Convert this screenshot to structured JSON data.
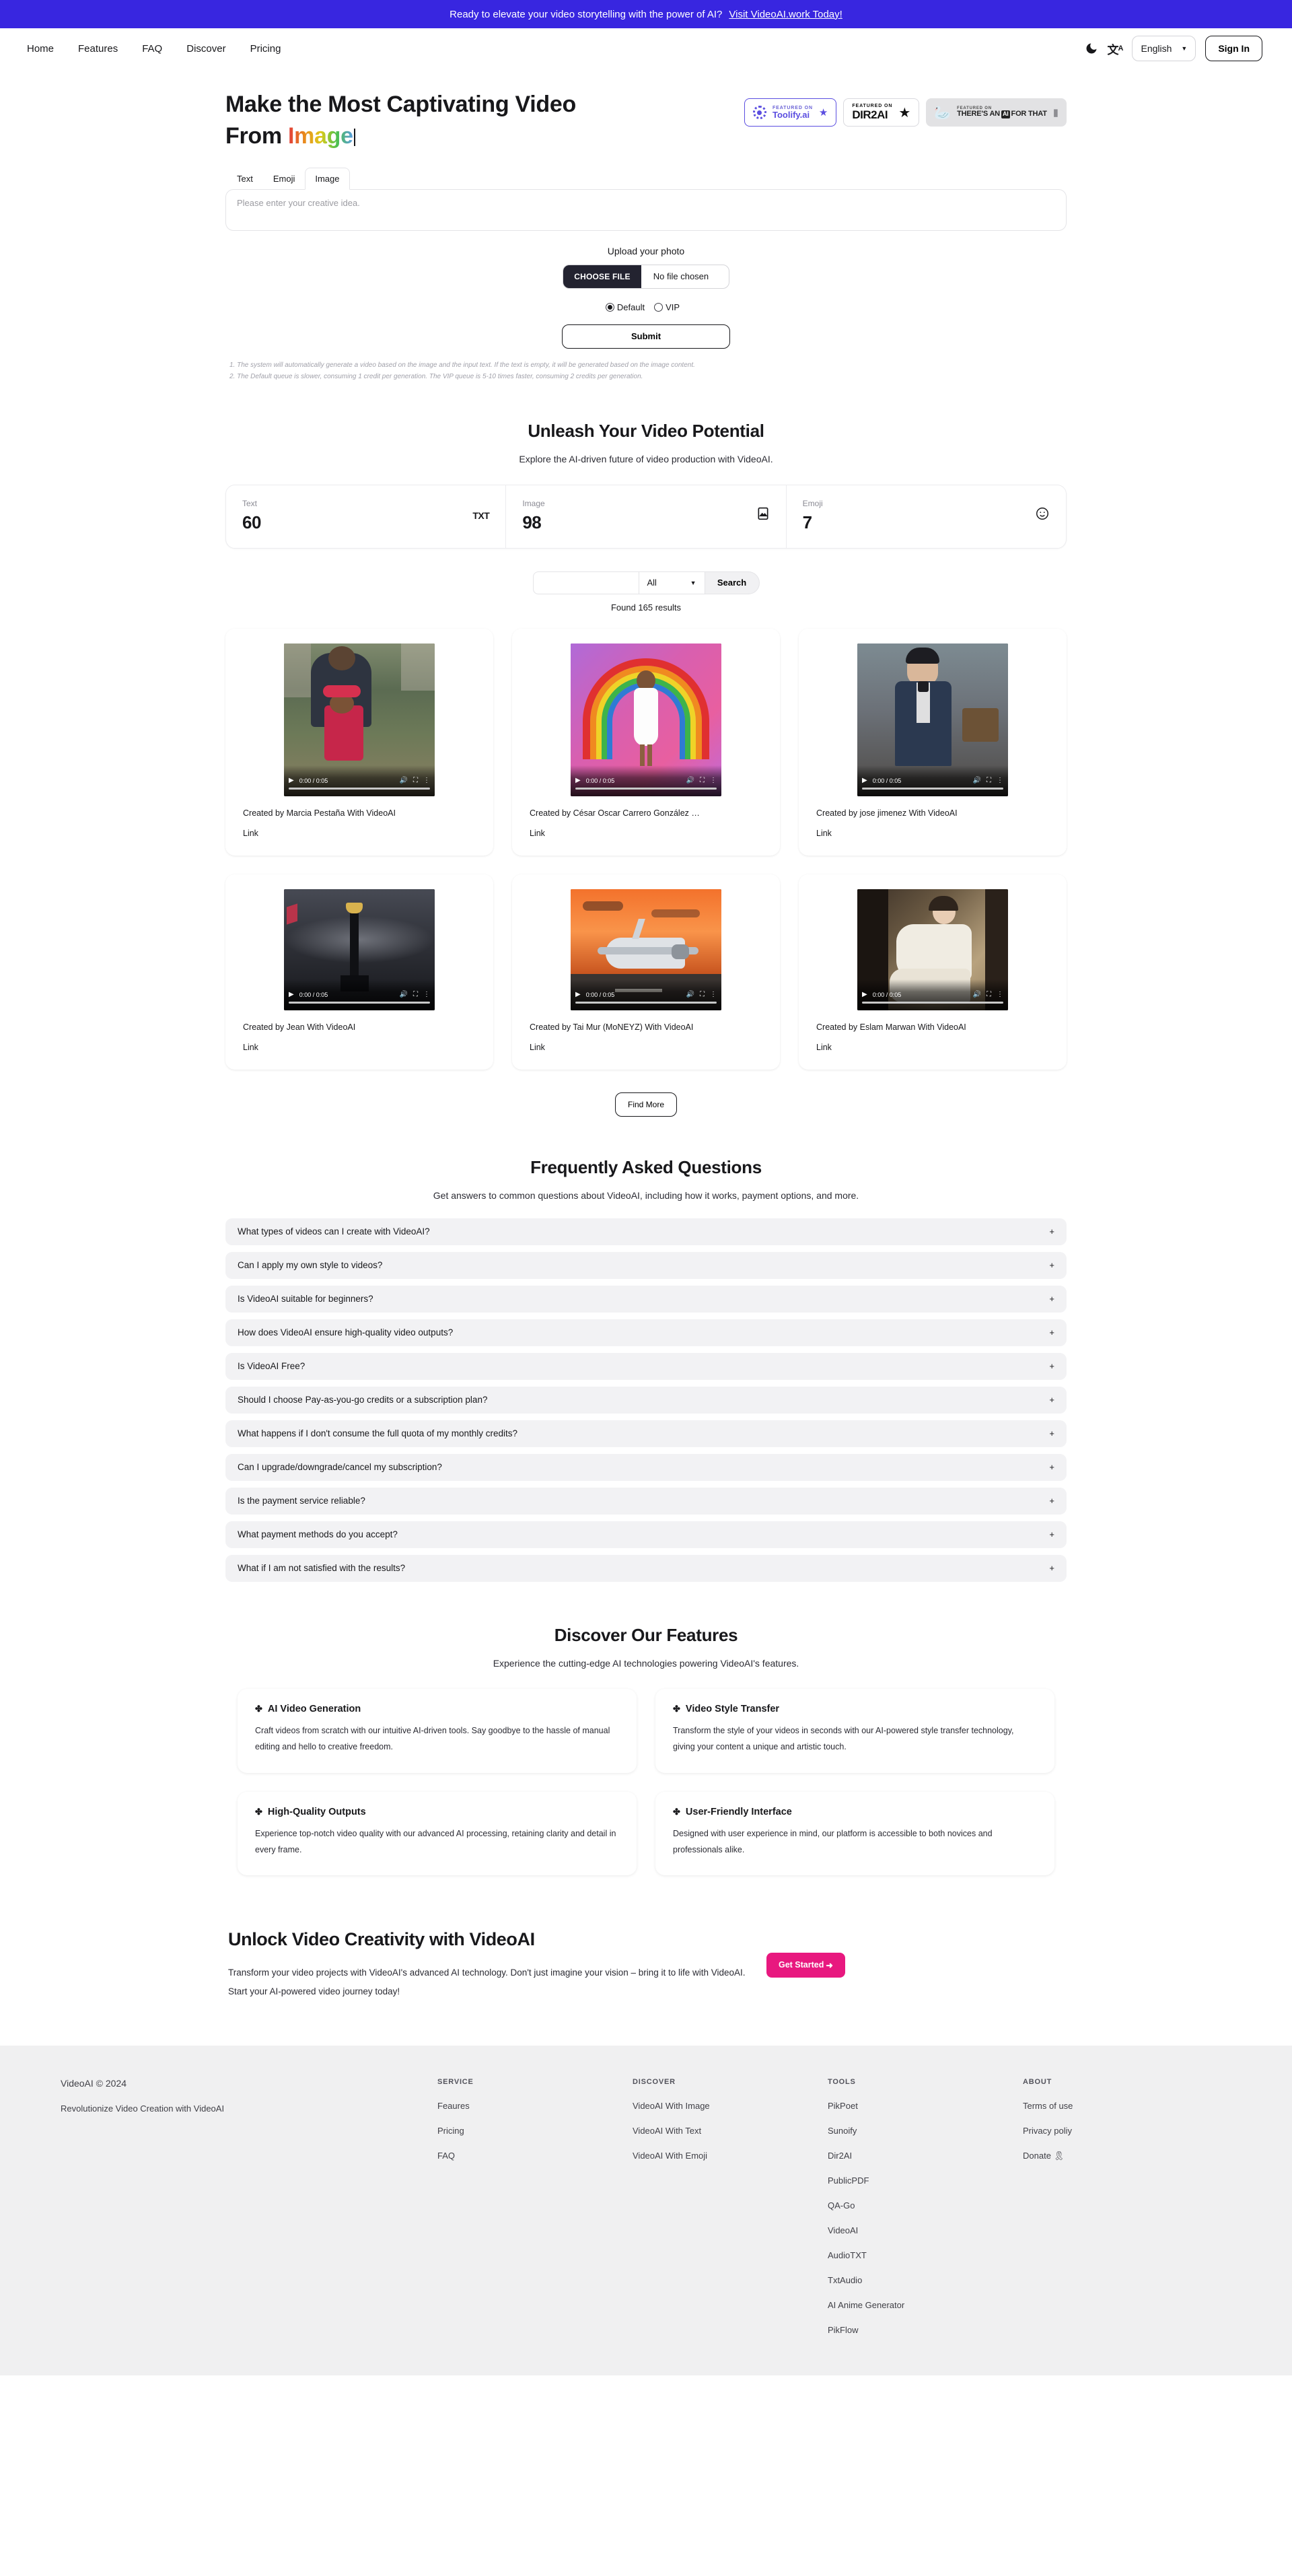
{
  "announcement": {
    "text": "Ready to elevate your video storytelling with the power of AI?",
    "link_label": "Visit VideoAI.work Today!",
    "bg": "#3826e0"
  },
  "header": {
    "nav": [
      {
        "label": "Home"
      },
      {
        "label": "Features"
      },
      {
        "label": "FAQ"
      },
      {
        "label": "Discover"
      },
      {
        "label": "Pricing"
      }
    ],
    "dark_mode_icon": "moon-icon",
    "translate_icon": "translate-icon",
    "language": "English",
    "language_caret": "▼",
    "sign_in": "Sign In"
  },
  "hero": {
    "title_line1": "Make the Most Captivating Video",
    "title_line2_prefix": "From ",
    "title_gradient_word": "Image",
    "badges": [
      {
        "kicker": "FEATURED ON",
        "name": "Toolify.ai",
        "mark": "★"
      },
      {
        "kicker": "FEATURED  ON",
        "name": "DIR2AI",
        "mark": "★"
      },
      {
        "kicker": "FEATURED ON",
        "name_pre": "THERE'S AN",
        "name_chip": "AI",
        "name_post": "FOR THAT",
        "mark": "🔖"
      }
    ],
    "tabs": [
      {
        "label": "Text",
        "active": false
      },
      {
        "label": "Emoji",
        "active": false
      },
      {
        "label": "Image",
        "active": true
      }
    ],
    "prompt_placeholder": "Please enter your creative idea.",
    "prompt_value": "",
    "upload_label": "Upload your photo",
    "choose_file_label": "CHOOSE FILE",
    "file_name": "No file chosen",
    "queue_options": [
      {
        "label": "Default",
        "selected": true
      },
      {
        "label": "VIP",
        "selected": false
      }
    ],
    "submit_label": "Submit",
    "notes": [
      "1. The system will automatically generate a video based on the image and the input text. If the text is empty, it will be generated based on the image content.",
      "2. The Default queue is slower, consuming 1 credit per generation. The VIP queue is 5-10 times faster, consuming 2 credits per generation."
    ]
  },
  "potential": {
    "title": "Unleash Your Video Potential",
    "subtitle": "Explore the AI-driven future of video production with VideoAI.",
    "stats": [
      {
        "label": "Text",
        "value": "60",
        "icon": "txt-icon",
        "glyph": "TXT"
      },
      {
        "label": "Image",
        "value": "98",
        "icon": "image-icon",
        "glyph": "🖼"
      },
      {
        "label": "Emoji",
        "value": "7",
        "icon": "smiley-icon",
        "glyph": "☺"
      }
    ]
  },
  "search": {
    "value": "",
    "placeholder": "",
    "filter_selected": "All",
    "filter_caret": "▼",
    "button_label": "Search",
    "results_text": "Found 165 results"
  },
  "videos": [
    {
      "caption": "Created by Marcia Pestaña With VideoAI",
      "link_label": "Link",
      "time": "0:00 / 0:05",
      "thumb": "family-fair",
      "tall": true
    },
    {
      "caption": "Created by César Oscar Carrero González …",
      "link_label": "Link",
      "time": "0:00 / 0:05",
      "thumb": "rainbow-girl",
      "tall": true
    },
    {
      "caption": "Created by jose jimenez With VideoAI",
      "link_label": "Link",
      "time": "0:00 / 0:05",
      "thumb": "officer-portrait",
      "tall": true
    },
    {
      "caption": "Created by Jean With VideoAI",
      "link_label": "Link",
      "time": "0:00 / 0:05",
      "thumb": "stadium-trophy",
      "tall": false
    },
    {
      "caption": "Created by Tai Mur (MoNEYZ) With VideoAI",
      "link_label": "Link",
      "time": "0:00 / 0:05",
      "thumb": "jet-sunset",
      "tall": false
    },
    {
      "caption": "Created by Eslam Marwan With VideoAI",
      "link_label": "Link",
      "time": "0:00 / 0:05",
      "thumb": "woman-chair",
      "tall": false
    }
  ],
  "find_more_label": "Find More",
  "faq": {
    "title": "Frequently Asked Questions",
    "subtitle": "Get answers to common questions about VideoAI, including how it works, payment options, and more.",
    "expand_icon": "+",
    "items": [
      {
        "question": "What types of videos can I create with VideoAI?"
      },
      {
        "question": "Can I apply my own style to videos?"
      },
      {
        "question": "Is VideoAI suitable for beginners?"
      },
      {
        "question": "How does VideoAI ensure high-quality video outputs?"
      },
      {
        "question": "Is VideoAI Free?"
      },
      {
        "question": "Should I choose Pay-as-you-go credits or a subscription plan?"
      },
      {
        "question": "What happens if I don't consume the full quota of my monthly credits?"
      },
      {
        "question": "Can I upgrade/downgrade/cancel my subscription?"
      },
      {
        "question": "Is the payment service reliable?"
      },
      {
        "question": "What payment methods do you accept?"
      },
      {
        "question": "What if I am not satisfied with the results?"
      }
    ]
  },
  "features": {
    "title": "Discover Our Features",
    "subtitle": "Experience the cutting-edge AI technologies powering VideoAI's features.",
    "items": [
      {
        "icon": "sparkle-icon",
        "title": "AI Video Generation",
        "body": "Craft videos from scratch with our intuitive AI-driven tools. Say goodbye to the hassle of manual editing and hello to creative freedom."
      },
      {
        "icon": "sparkle-icon",
        "title": "Video Style Transfer",
        "body": "Transform the style of your videos in seconds with our AI-powered style transfer technology, giving your content a unique and artistic touch."
      },
      {
        "icon": "sparkle-icon",
        "title": "High-Quality Outputs",
        "body": "Experience top-notch video quality with our advanced AI processing, retaining clarity and detail in every frame."
      },
      {
        "icon": "sparkle-icon",
        "title": "User-Friendly Interface",
        "body": "Designed with user experience in mind, our platform is accessible to both novices and professionals alike."
      }
    ]
  },
  "cta": {
    "title": "Unlock Video Creativity with VideoAI",
    "body": "Transform your video projects with VideoAI's advanced AI technology. Don't just imagine your vision – bring it to life with VideoAI. Start your AI-powered video journey today!",
    "button_label": "Get Started",
    "button_arrow": "➜",
    "button_color": "#e8187f"
  },
  "footer": {
    "brand": "VideoAI © 2024",
    "tagline": "Revolutionize Video Creation with VideoAI",
    "columns": [
      {
        "head": "SERVICE",
        "links": [
          {
            "label": "Feaures"
          },
          {
            "label": "Pricing"
          },
          {
            "label": "FAQ"
          }
        ]
      },
      {
        "head": "DISCOVER",
        "links": [
          {
            "label": "VideoAI With Image"
          },
          {
            "label": "VideoAI With Text"
          },
          {
            "label": "VideoAI With Emoji"
          }
        ]
      },
      {
        "head": "TOOLS",
        "links": [
          {
            "label": "PikPoet"
          },
          {
            "label": "Sunoify"
          },
          {
            "label": "Dir2AI"
          },
          {
            "label": "PublicPDF"
          },
          {
            "label": "QA-Go"
          },
          {
            "label": "VideoAI"
          },
          {
            "label": "AudioTXT"
          },
          {
            "label": "TxtAudio"
          },
          {
            "label": "AI Anime Generator"
          },
          {
            "label": "PikFlow"
          }
        ]
      },
      {
        "head": "ABOUT",
        "links": [
          {
            "label": "Terms of use"
          },
          {
            "label": "Privacy poliy"
          },
          {
            "label": "Donate 🎗"
          }
        ]
      }
    ]
  }
}
